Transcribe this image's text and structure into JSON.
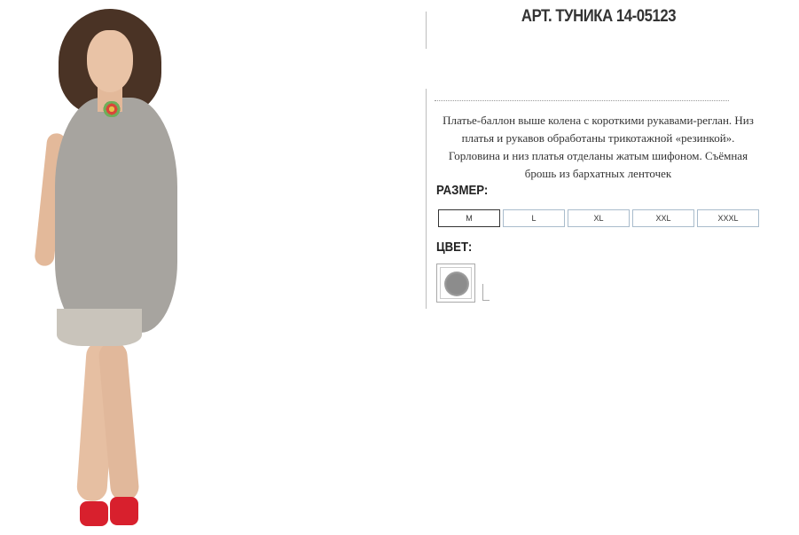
{
  "product": {
    "title": "АРТ. ТУНИКА 14-05123",
    "description_lines": [
      "Платье-баллон выше колена с короткими рукавами-реглан. Низ",
      "платья и рукавов обработаны трикотажной «резинкой».",
      "Горловина и низ платья отделаны жатым шифоном. Съёмная",
      "брошь из бархатных ленточек"
    ]
  },
  "size_section": {
    "label": "РАЗМЕР:",
    "selected": "M",
    "options": [
      "M",
      "L",
      "XL",
      "XXL",
      "XXXL"
    ]
  },
  "color_section": {
    "label": "ЦВЕТ:",
    "swatches": [
      {
        "name": "grey",
        "color": "#8c8c8c"
      }
    ]
  }
}
